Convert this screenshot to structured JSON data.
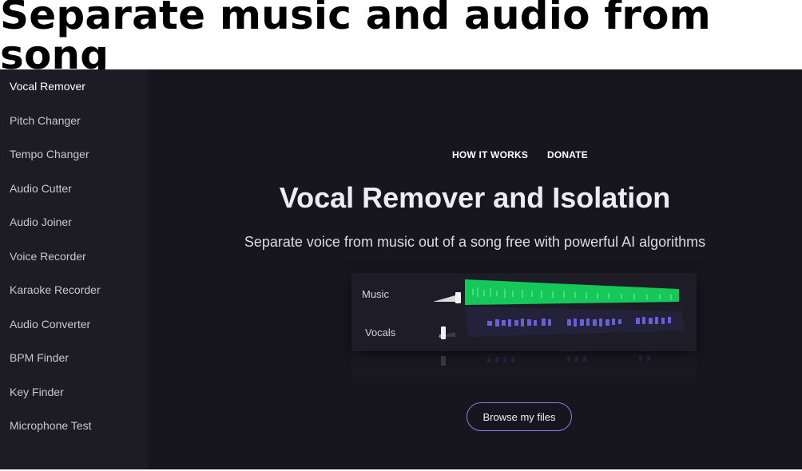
{
  "banner": {
    "title": "Separate music and audio from song"
  },
  "sidebar": {
    "items": [
      {
        "label": "Vocal Remover",
        "active": true
      },
      {
        "label": "Pitch Changer"
      },
      {
        "label": "Tempo Changer"
      },
      {
        "label": "Audio Cutter"
      },
      {
        "label": "Audio Joiner"
      },
      {
        "label": "Voice Recorder"
      },
      {
        "label": "Karaoke Recorder"
      },
      {
        "label": "Audio Converter"
      },
      {
        "label": "BPM Finder"
      },
      {
        "label": "Key Finder"
      },
      {
        "label": "Microphone Test"
      }
    ]
  },
  "nav": {
    "how_it_works": "HOW IT WORKS",
    "donate": "DONATE"
  },
  "hero": {
    "title": "Vocal Remover and Isolation",
    "subtitle": "Separate voice from music out of a song free with powerful AI algorithms"
  },
  "mixer": {
    "tracks": [
      {
        "label": "Music",
        "color": "#22d46a",
        "icon": "fader-icon"
      },
      {
        "label": "Vocals",
        "color": "#6b5fd6",
        "icon": "fader-icon"
      }
    ]
  },
  "actions": {
    "browse_label": "Browse my files"
  },
  "colors": {
    "sidebar_bg": "#1d1c25",
    "main_bg": "#17161e",
    "music_wave": "#22d46a",
    "vocals_wave": "#6b5fd6",
    "button_border": "#8b7ce8"
  }
}
